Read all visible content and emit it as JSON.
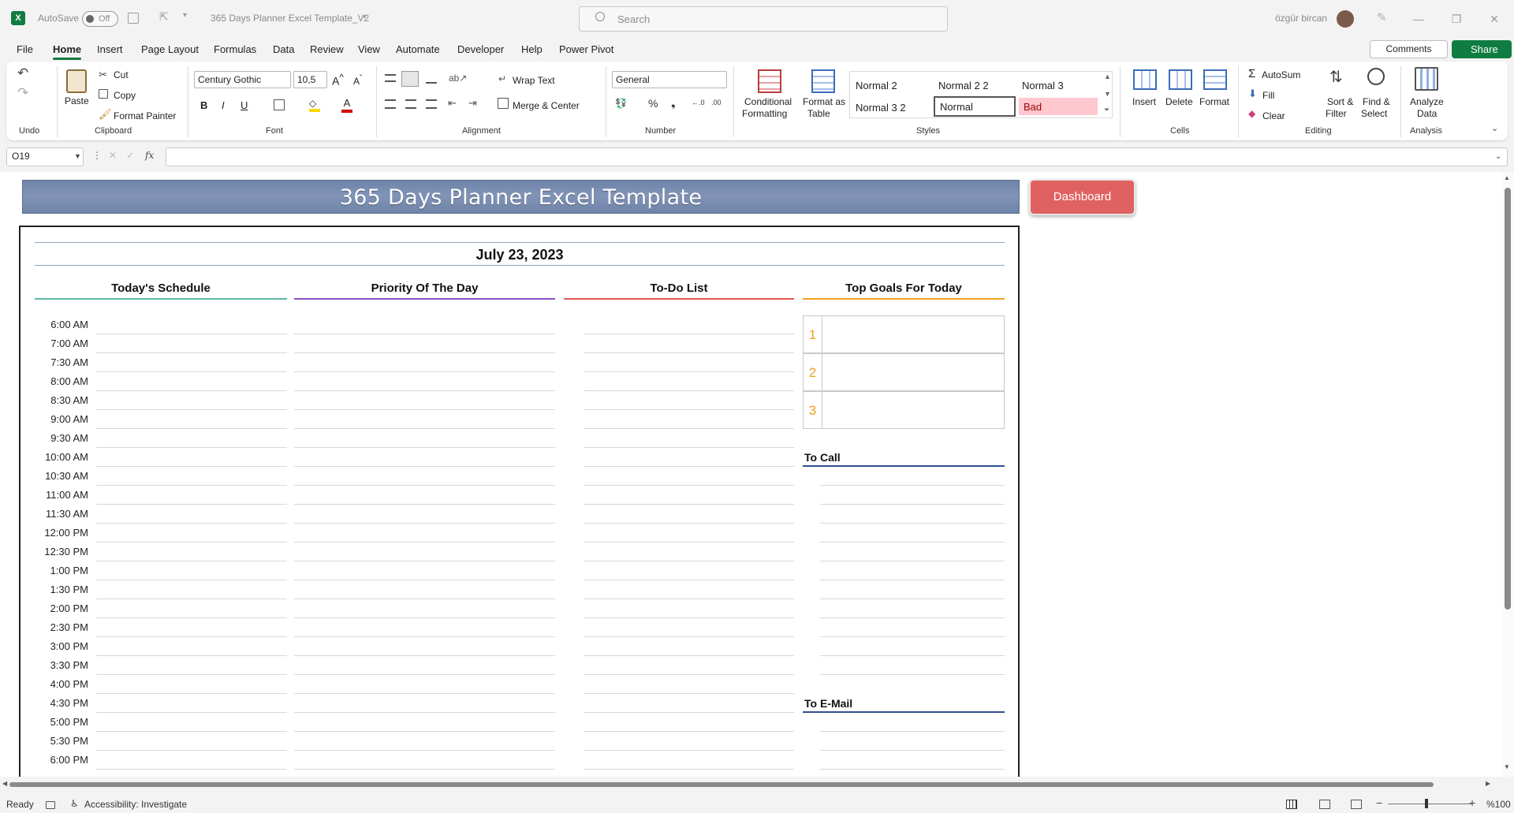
{
  "titlebar": {
    "autosave_label": "AutoSave",
    "autosave_state": "Off",
    "doc_title": "365 Days Planner Excel Template_V2",
    "search_placeholder": "Search",
    "user_name": "özgür bircan"
  },
  "menu": [
    "File",
    "Home",
    "Insert",
    "Page Layout",
    "Formulas",
    "Data",
    "Review",
    "View",
    "Automate",
    "Developer",
    "Help",
    "Power Pivot"
  ],
  "menu_active": "Home",
  "comments_label": "Comments",
  "share_label": "Share",
  "ribbon": {
    "clipboard": {
      "paste": "Paste",
      "cut": "Cut",
      "copy": "Copy",
      "format_painter": "Format Painter",
      "group": "Clipboard"
    },
    "undo_group": "Undo",
    "font": {
      "name": "Century Gothic",
      "size": "10,5",
      "group": "Font"
    },
    "alignment": {
      "wrap": "Wrap Text",
      "merge": "Merge & Center",
      "group": "Alignment"
    },
    "number": {
      "format": "General",
      "group": "Number"
    },
    "styles": {
      "cond_fmt_1": "Conditional",
      "cond_fmt_2": "Formatting",
      "fmt_table_1": "Format as",
      "fmt_table_2": "Table",
      "cells": [
        "Normal 2",
        "Normal 2 2",
        "Normal 3",
        "Normal 3 2",
        "Normal",
        "Bad"
      ],
      "group": "Styles"
    },
    "cells": {
      "insert": "Insert",
      "delete": "Delete",
      "format": "Format",
      "group": "Cells"
    },
    "editing": {
      "autosum": "AutoSum",
      "fill": "Fill",
      "clear": "Clear",
      "sort_1": "Sort &",
      "sort_2": "Filter",
      "find_1": "Find &",
      "find_2": "Select",
      "group": "Editing"
    },
    "analysis": {
      "analyze_1": "Analyze",
      "analyze_2": "Data",
      "group": "Analysis"
    }
  },
  "namebox": "O19",
  "sheet": {
    "banner": "365 Days Planner Excel Template",
    "dashboard_button": "Dashboard",
    "date": "July 23, 2023",
    "columns": {
      "schedule": "Today's Schedule",
      "priority": "Priority Of The Day",
      "todo": "To-Do List",
      "goals": "Top Goals For Today"
    },
    "times": [
      "6:00 AM",
      "7:00 AM",
      "7:30 AM",
      "8:00 AM",
      "8:30 AM",
      "9:00 AM",
      "9:30 AM",
      "10:00 AM",
      "10:30 AM",
      "11:00 AM",
      "11:30 AM",
      "12:00 PM",
      "12:30 PM",
      "1:00 PM",
      "1:30 PM",
      "2:00 PM",
      "2:30 PM",
      "3:00 PM",
      "3:30 PM",
      "4:00 PM",
      "4:30 PM",
      "5:00 PM",
      "5:30 PM",
      "6:00 PM"
    ],
    "goals": [
      "1",
      "2",
      "3"
    ],
    "to_call": "To Call",
    "to_email": "To E-Mail"
  },
  "status": {
    "ready": "Ready",
    "accessibility": "Accessibility: Investigate",
    "zoom": "%100"
  },
  "colors": {
    "excel_green": "#107c41",
    "banner": "#7a8db0",
    "dashboard": "#e06161",
    "schedule_line": "#5fb7a8",
    "priority_line": "#8a4fc8",
    "todo_line": "#e0574f",
    "goals_line": "#f0a020",
    "goal_number": "#f0a020"
  }
}
